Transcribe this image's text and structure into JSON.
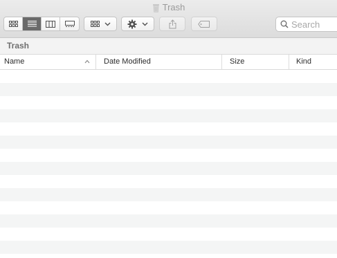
{
  "window": {
    "title": "Trash"
  },
  "toolbar": {
    "view_modes": [
      {
        "name": "icon-view",
        "icon": "grid-icon",
        "active": false
      },
      {
        "name": "list-view",
        "icon": "list-icon",
        "active": true
      },
      {
        "name": "column-view",
        "icon": "columns-icon",
        "active": false
      },
      {
        "name": "gallery-view",
        "icon": "gallery-icon",
        "active": false
      }
    ],
    "group_icon": "grid-icon",
    "action_icon": "gear-icon",
    "share_icon": "share-icon",
    "tag_icon": "tag-icon"
  },
  "search": {
    "placeholder": "Search"
  },
  "pathbar": {
    "label": "Trash"
  },
  "columns": {
    "name": "Name",
    "date_modified": "Date Modified",
    "size": "Size",
    "kind": "Kind"
  },
  "rows": {
    "stripe_colors": [
      "#ffffff",
      "#f4f5f5"
    ]
  }
}
